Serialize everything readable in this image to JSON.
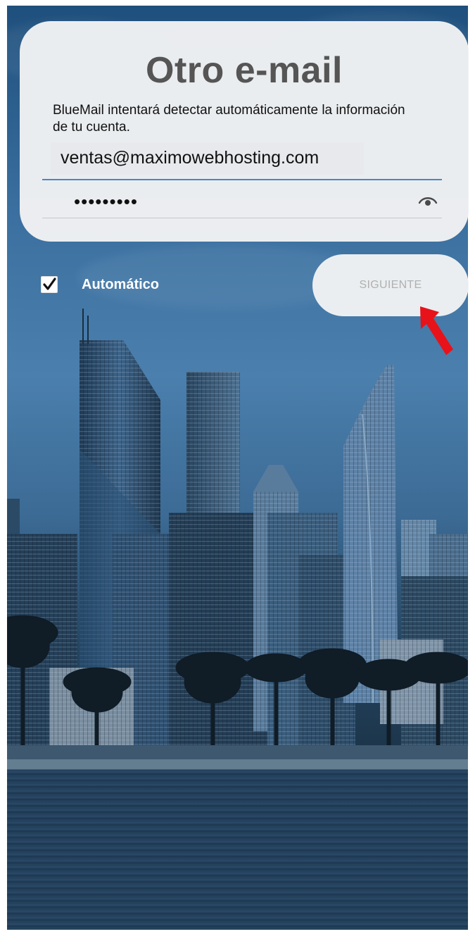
{
  "setup": {
    "title": "Otro e-mail",
    "description": "BlueMail intentará detectar automáticamente la información de tu cuenta."
  },
  "email": {
    "value": "ventas@maximowebhosting.com"
  },
  "password": {
    "masked_value": "•••••••••",
    "toggle_icon": "eye-icon"
  },
  "automatic": {
    "label": "Automático",
    "checked": true
  },
  "next_button": {
    "label": "SIGUIENTE"
  },
  "colors": {
    "accent": "#4a86c8",
    "annotation": "#e8121a",
    "card": "#f1f2f3",
    "title": "#555555",
    "disabled_text": "#b0b0b0"
  }
}
